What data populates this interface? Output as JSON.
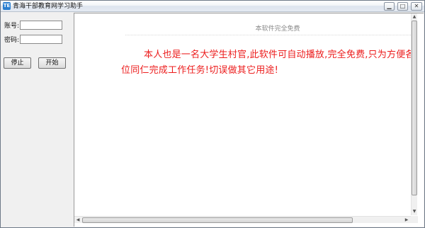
{
  "window": {
    "title": "青海干部教育网学习助手",
    "app_icon_text": "TE"
  },
  "title_buttons": {
    "minimize": "▁",
    "maximize": "□",
    "close": "✕"
  },
  "login": {
    "account_label": "账号:",
    "account_value": "",
    "password_label": "密码:",
    "password_value": ""
  },
  "buttons": {
    "stop": "停止",
    "start": "开始"
  },
  "content": {
    "subtitle": "本软件完全免费",
    "notice": "本人也是一名大学生村官,此软件可自动播放,完全免费,只为方便各位同仁完成工作任务!切误做其它用途!"
  },
  "scrollbar_glyphs": {
    "up": "▲",
    "down": "▼",
    "left": "◀",
    "right": "▶"
  },
  "colors": {
    "notice_text": "#ec1c1c",
    "subtitle_text": "#8a8a8a"
  }
}
